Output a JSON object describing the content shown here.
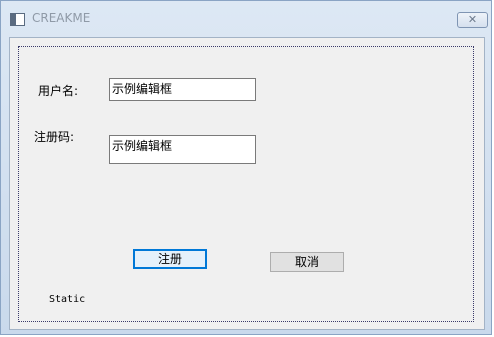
{
  "window": {
    "title": "CREAKME",
    "close_symbol": "✕",
    "icons": {
      "app": "window-app-icon",
      "close": "close-icon"
    }
  },
  "form": {
    "username_label": "用户名:",
    "username_value": "示例编辑框",
    "regcode_label": "注册码:",
    "regcode_value": "示例编辑框",
    "register_button": "注册",
    "cancel_button": "取消",
    "static_text": "Static"
  },
  "colors": {
    "default_button_border": "#0078d7",
    "client_background": "#f0f0f0"
  }
}
